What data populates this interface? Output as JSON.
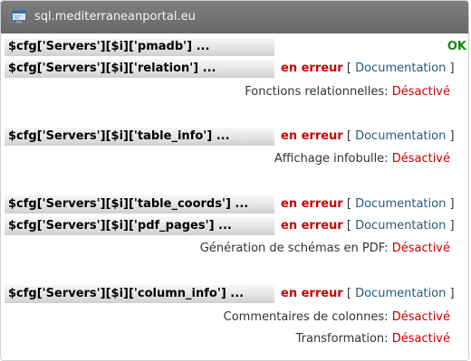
{
  "window": {
    "title": "sql.mediterraneanportal.eu",
    "icon": "browser-window-icon"
  },
  "rows": [
    {
      "key": "$cfg['Servers'][$i]['pmadb'] ...",
      "status": "OK"
    },
    {
      "key": "$cfg['Servers'][$i]['relation'] ...",
      "status": "en erreur",
      "doc_open": "[",
      "doc_label": "Documentation",
      "doc_close": "]"
    },
    {
      "key": "$cfg['Servers'][$i]['table_info'] ...",
      "status": "en erreur",
      "doc_open": "[",
      "doc_label": "Documentation",
      "doc_close": "]"
    },
    {
      "key": "$cfg['Servers'][$i]['table_coords'] ...",
      "status": "en erreur",
      "doc_open": "[",
      "doc_label": "Documentation",
      "doc_close": "]"
    },
    {
      "key": "$cfg['Servers'][$i]['pdf_pages'] ...",
      "status": "en erreur",
      "doc_open": "[",
      "doc_label": "Documentation",
      "doc_close": "]"
    },
    {
      "key": "$cfg['Servers'][$i]['column_info'] ...",
      "status": "en erreur",
      "doc_open": "[",
      "doc_label": "Documentation",
      "doc_close": "]"
    }
  ],
  "features": [
    {
      "label": "Fonctions relationnelles:",
      "value": "Désactivé"
    },
    {
      "label": "Affichage infobulle:",
      "value": "Désactivé"
    },
    {
      "label": "Génération de schémas en PDF:",
      "value": "Désactivé"
    },
    {
      "label": "Commentaires de colonnes:",
      "value": "Désactivé"
    },
    {
      "label": "Transformation:",
      "value": "Désactivé"
    }
  ],
  "colors": {
    "ok": "#128912",
    "error": "#cc0000",
    "link": "#235a81",
    "titlebar": "#707070"
  }
}
